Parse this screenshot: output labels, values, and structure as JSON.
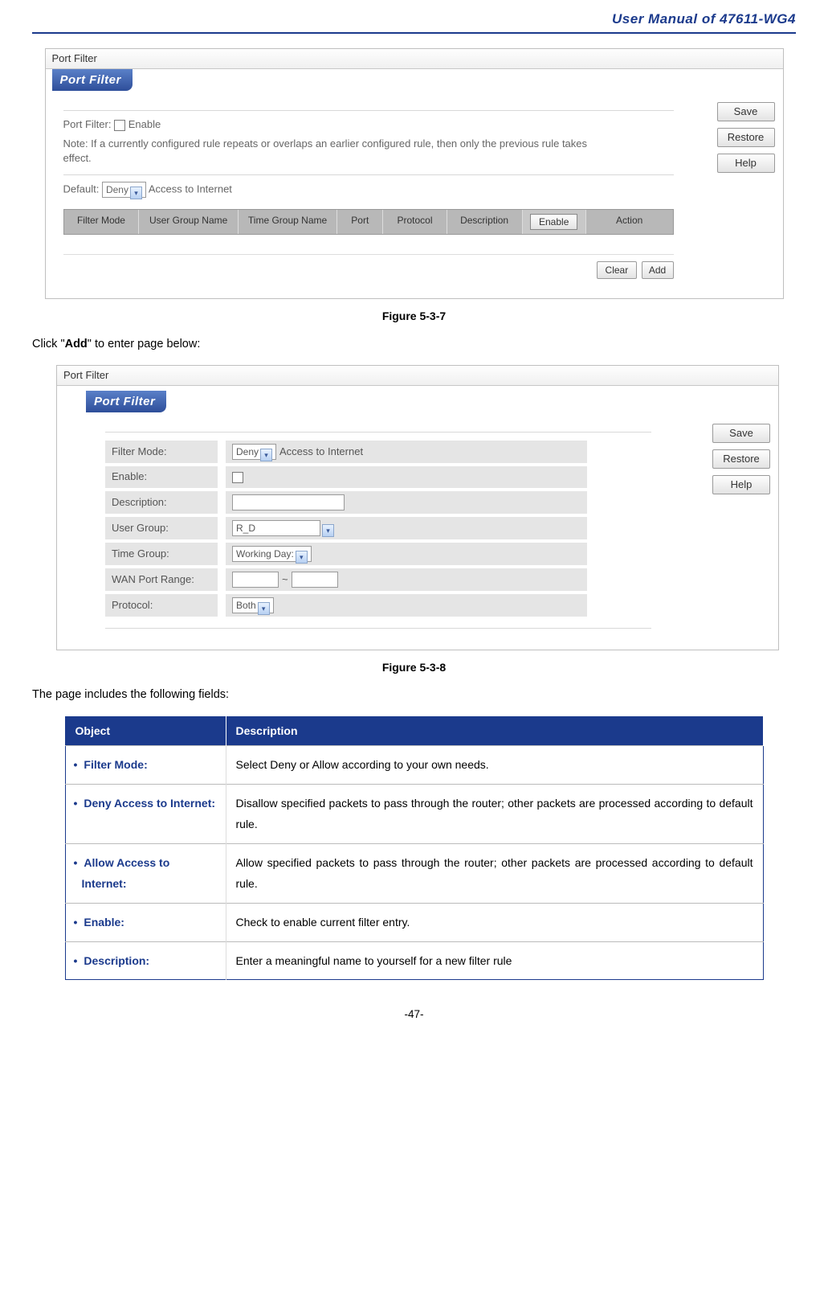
{
  "header": {
    "title": "User Manual of 47611-WG4"
  },
  "shot1": {
    "titlebar": "Port Filter",
    "section": "Port Filter",
    "port_filter_label": "Port Filter:",
    "enable_label": "Enable",
    "note": "Note: If a currently configured rule repeats or overlaps an earlier configured rule, then only the previous rule takes effect.",
    "default_label": "Default:",
    "default_value": "Deny",
    "default_suffix": "Access to Internet",
    "columns": {
      "c1": "Filter Mode",
      "c2": "User Group Name",
      "c3": "Time Group Name",
      "c4": "Port",
      "c5": "Protocol",
      "c6": "Description",
      "c7": "Enable",
      "c8": "Action"
    },
    "buttons": {
      "save": "Save",
      "restore": "Restore",
      "help": "Help",
      "clear": "Clear",
      "add": "Add"
    }
  },
  "caption1": "Figure 5-3-7",
  "body1_pre": "Click \"",
  "body1_bold": "Add",
  "body1_post": "\" to enter page below:",
  "shot2": {
    "titlebar": "Port Filter",
    "section": "Port Filter",
    "rows": {
      "filter_mode_label": "Filter Mode:",
      "filter_mode_value": "Deny",
      "filter_mode_suffix": "Access to Internet",
      "enable_label": "Enable:",
      "description_label": "Description:",
      "user_group_label": "User Group:",
      "user_group_value": "R_D",
      "time_group_label": "Time Group:",
      "time_group_value": "Working Day:",
      "wan_port_label": "WAN Port Range:",
      "protocol_label": "Protocol:",
      "protocol_value": "Both"
    },
    "buttons": {
      "save": "Save",
      "restore": "Restore",
      "help": "Help"
    }
  },
  "caption2": "Figure 5-3-8",
  "body2": "The page includes the following fields:",
  "desc_table": {
    "h1": "Object",
    "h2": "Description",
    "rows": [
      {
        "obj": "Filter Mode:",
        "desc": "Select Deny or Allow according to your own needs."
      },
      {
        "obj": "Deny Access to Internet:",
        "desc": "Disallow specified packets to pass through the router; other packets are processed according to default rule."
      },
      {
        "obj": "Allow Access to Internet:",
        "desc": "Allow specified packets to pass through the router; other packets are processed according to default rule."
      },
      {
        "obj": "Enable:",
        "desc": "Check to enable current filter entry."
      },
      {
        "obj": "Description:",
        "desc": "Enter a meaningful name to yourself for a new filter rule"
      }
    ]
  },
  "page_number": "-47-"
}
